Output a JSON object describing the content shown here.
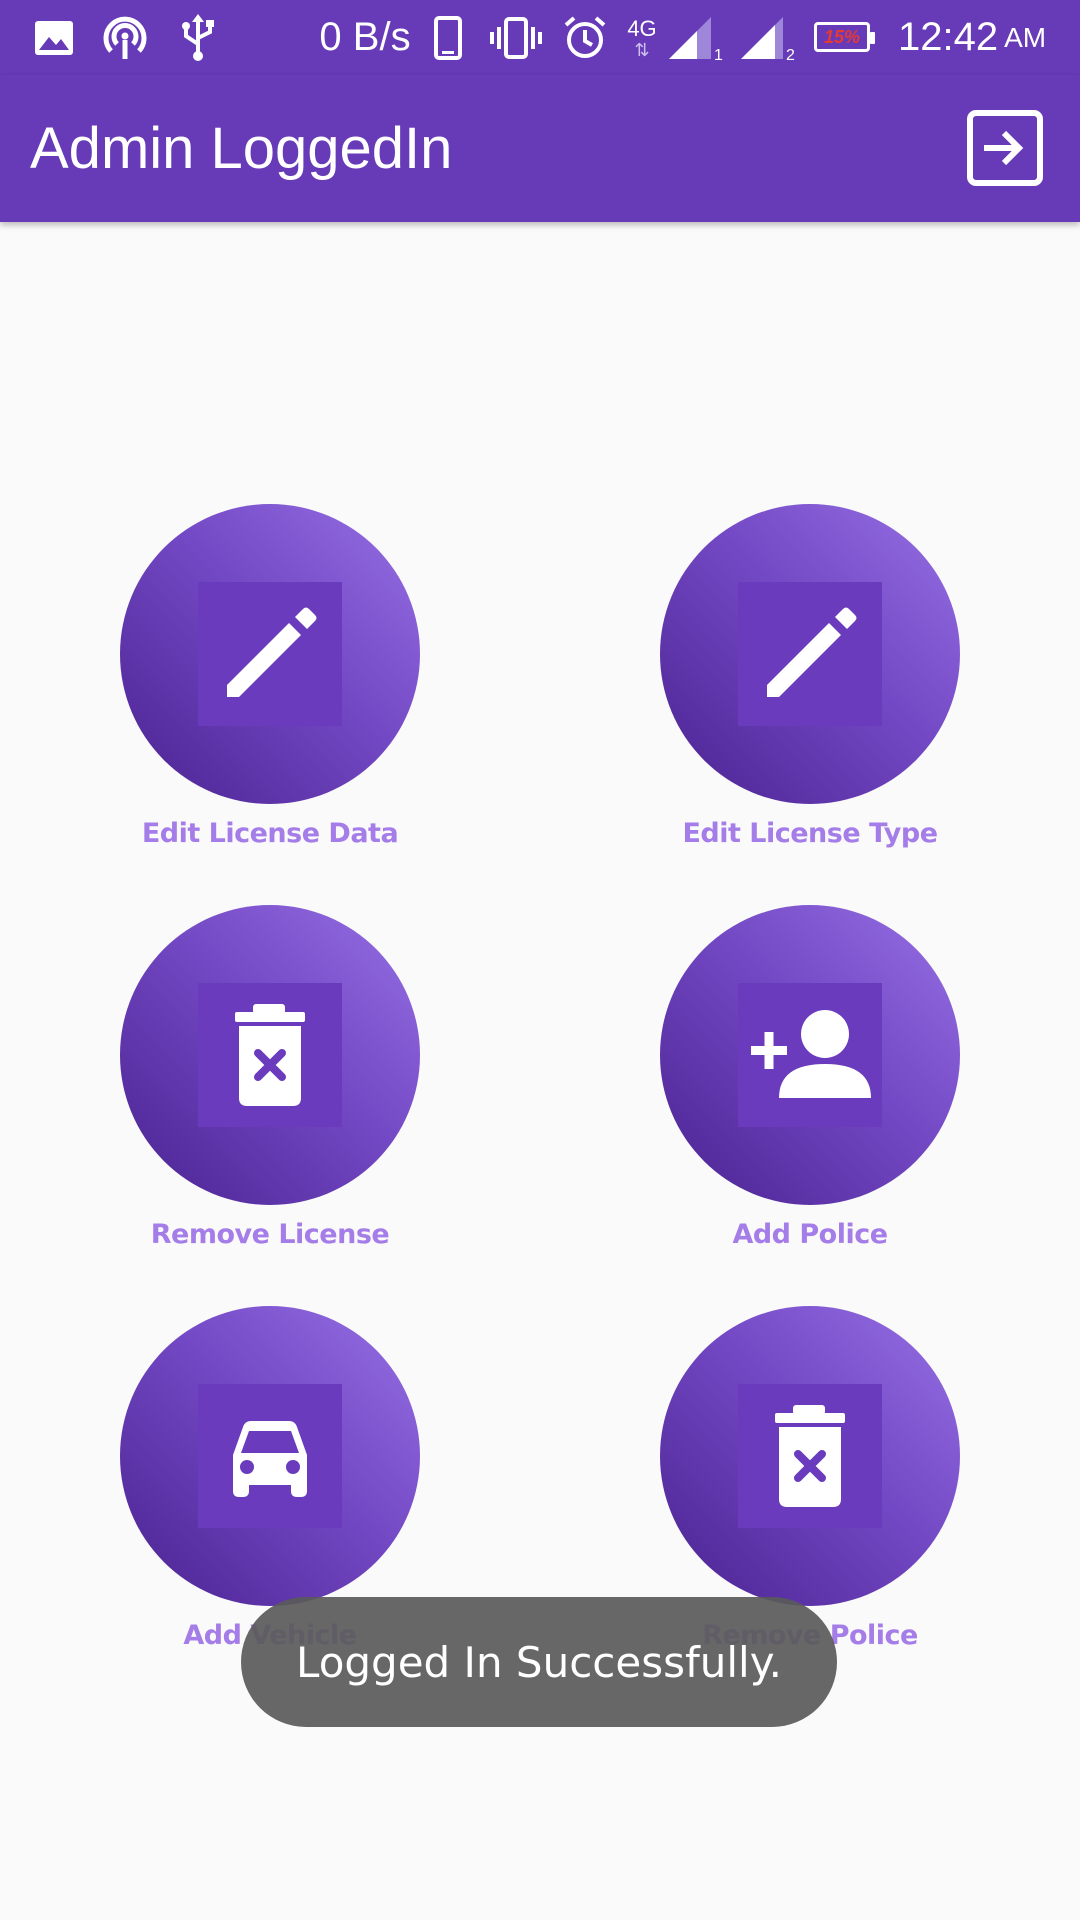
{
  "status_bar": {
    "net_speed": "0 B/s",
    "network_type": "4G",
    "sim1": "1",
    "sim2": "2",
    "battery": "15%",
    "time": "12:42",
    "ampm": "AM",
    "icons": [
      "image-icon",
      "hotspot-icon",
      "usb-icon",
      "phone-icon",
      "vibrate-icon",
      "alarm-icon",
      "signal-icon",
      "battery-icon"
    ]
  },
  "app_bar": {
    "title": "Admin LoggedIn",
    "logout_icon": "logout-icon"
  },
  "menu": {
    "items": [
      {
        "label": "Edit License Data",
        "icon": "pencil-icon"
      },
      {
        "label": "Edit License Type",
        "icon": "pencil-icon"
      },
      {
        "label": "Remove License",
        "icon": "trash-x-icon"
      },
      {
        "label": "Add Police",
        "icon": "add-person-icon"
      },
      {
        "label": "Add Vehicle",
        "icon": "car-icon"
      },
      {
        "label": "Remove Police",
        "icon": "trash-x-icon"
      }
    ]
  },
  "toast": {
    "message": "Logged In Successfully."
  },
  "colors": {
    "primary": "#673ab7",
    "label": "#a57de8",
    "background": "#fafafa"
  }
}
